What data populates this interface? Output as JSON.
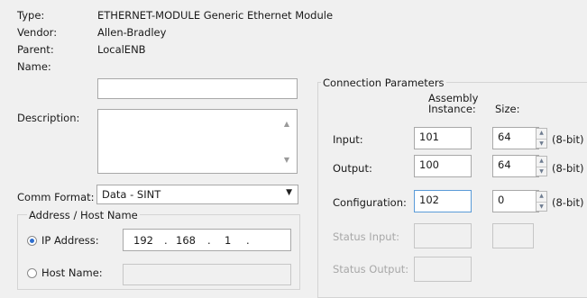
{
  "info": {
    "type_label": "Type:",
    "type_value": "ETHERNET-MODULE Generic Ethernet Module",
    "vendor_label": "Vendor:",
    "vendor_value": "Allen-Bradley",
    "parent_label": "Parent:",
    "parent_value": "LocalENB"
  },
  "form": {
    "name_label": "Name:",
    "name_value": "",
    "description_label": "Description:",
    "description_value": "",
    "comm_format_label": "Comm Format:",
    "comm_format_value": "Data - SINT"
  },
  "address_group": {
    "title": "Address / Host Name",
    "ip_label": "IP Address:",
    "ip_octets": [
      "192",
      "168",
      "1",
      ""
    ],
    "ip_selected": true,
    "host_label": "Host Name:",
    "host_value": ""
  },
  "connection": {
    "title": "Connection Parameters",
    "col_assembly_line1": "Assembly",
    "col_assembly_line2": "Instance:",
    "col_size": "Size:",
    "rows": [
      {
        "label": "Input:",
        "instance": "101",
        "size": "64",
        "unit": "(8-bit)"
      },
      {
        "label": "Output:",
        "instance": "100",
        "size": "64",
        "unit": "(8-bit)"
      },
      {
        "label": "Configuration:",
        "instance": "102",
        "size": "0",
        "unit": "(8-bit)"
      }
    ],
    "status_input_label": "Status Input:",
    "status_output_label": "Status Output:"
  },
  "colors": {
    "window_bg": "#f0f0f0",
    "focus_border": "#5a9bd8",
    "radio_dot": "#2d6ecf"
  }
}
